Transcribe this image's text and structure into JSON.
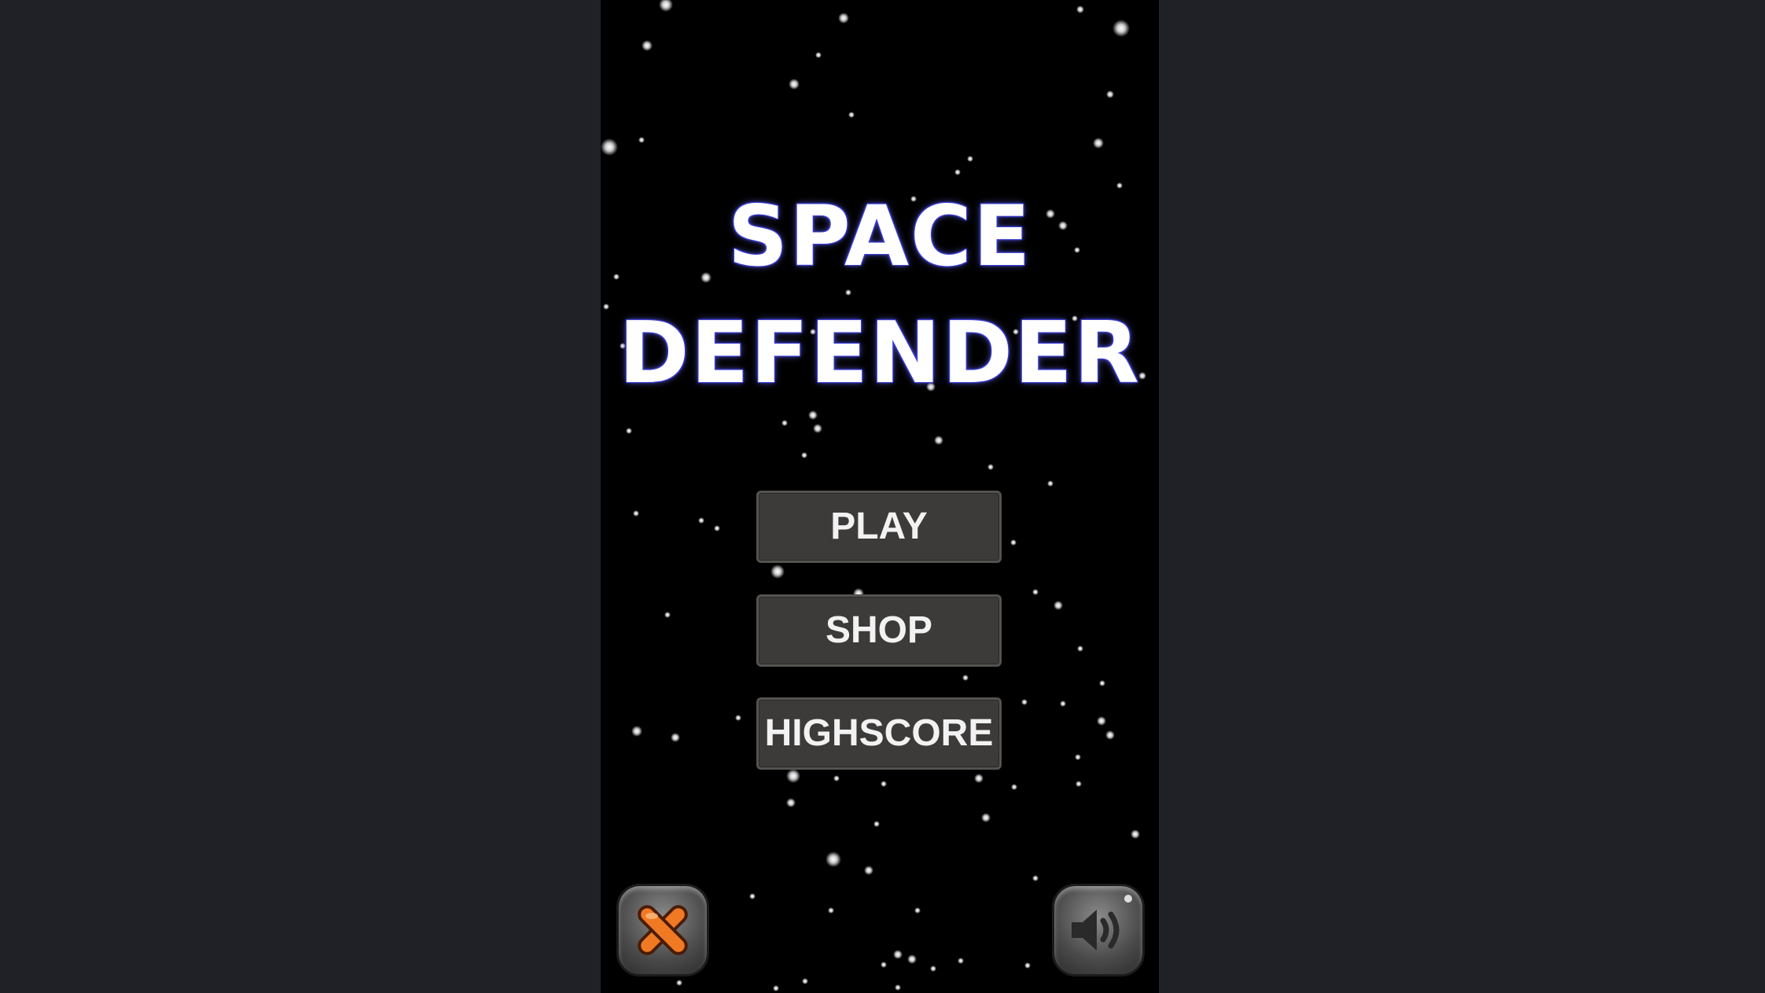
{
  "game": {
    "title_line1": "SPACE",
    "title_line2": "DEFENDER"
  },
  "menu": {
    "play_label": "PLAY",
    "shop_label": "SHOP",
    "highscore_label": "HIGHSCORE"
  },
  "controls": {
    "close_icon": "close-icon",
    "sound_icon": "speaker-icon"
  },
  "colors": {
    "background": "#000000",
    "letterbox": "#1f2126",
    "title_outline": "#3b3fd6",
    "button_bg": "#3d3b39",
    "close_x": "#e0651c"
  }
}
